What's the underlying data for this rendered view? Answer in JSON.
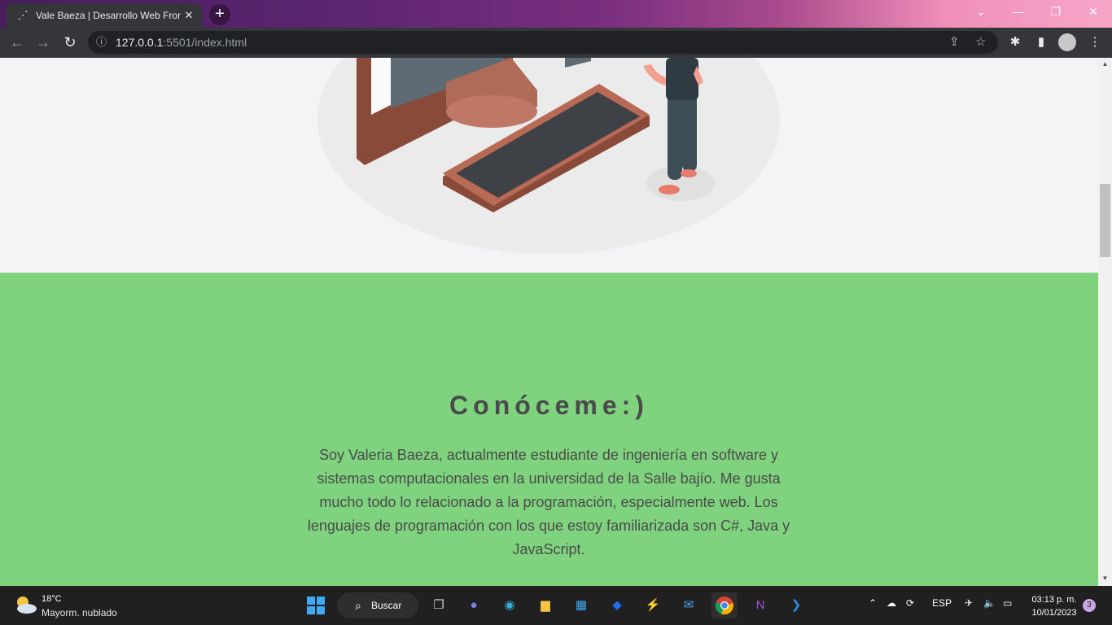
{
  "browser": {
    "tab_title": "Vale Baeza | Desarrollo Web Fron",
    "favicon": "vb-logo-icon",
    "url_host": "127.0.0.1",
    "url_rest": ":5501/index.html"
  },
  "page": {
    "about_title": "Conóceme:)",
    "about_text": "Soy Valeria Baeza, actualmente estudiante de ingeniería en software y sistemas computacionales en la universidad de la Salle bajío. Me gusta mucho todo lo relacionado a la programación, especialmente web. Los lenguajes de programación con los que estoy familiarizada son C#, Java y JavaScript.",
    "about_bg": "#7fd37e"
  },
  "taskbar": {
    "temperature": "18°C",
    "weather": "Mayorm. nublado",
    "search_label": "Buscar",
    "language": "ESP",
    "time": "03:13 p. m.",
    "date": "10/01/2023",
    "notification_count": "3"
  }
}
